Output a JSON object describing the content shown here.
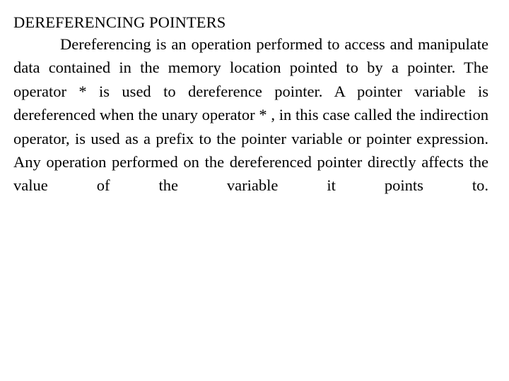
{
  "slide": {
    "title": "DEREFERENCING POINTERS",
    "body": "Dereferencing is an operation performed to access and manipulate data contained in the memory location pointed to by a pointer. The operator * is used to dereference pointer. A pointer variable is dereferenced when the unary operator * , in this case called the indirection operator, is used as a prefix to the pointer variable or pointer expression. Any operation performed on the dereferenced pointer directly affects the value of the variable it points to.",
    "background_color": "#ffffff",
    "text_color": "#000000"
  }
}
